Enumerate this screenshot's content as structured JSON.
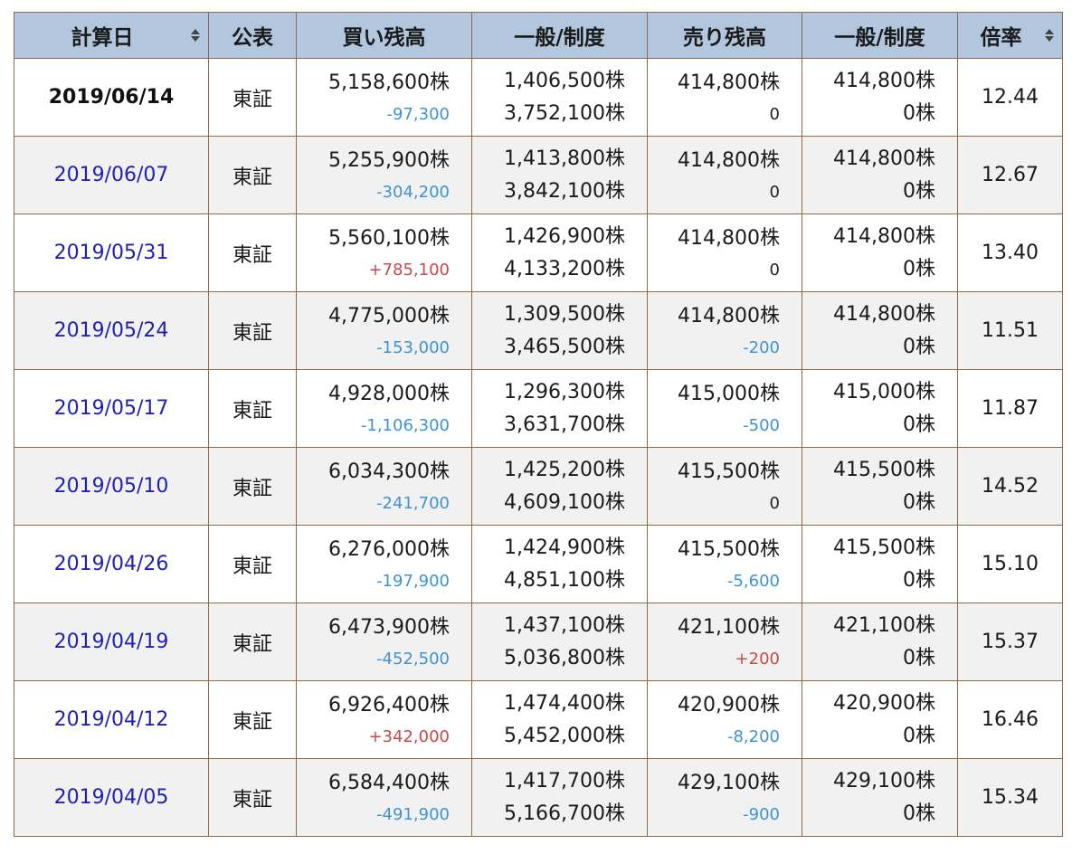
{
  "headers": {
    "date": "計算日",
    "published": "公表",
    "buy_balance": "買い残高",
    "buy_general_system": "一般/制度",
    "sell_balance": "売り残高",
    "sell_general_system": "一般/制度",
    "ratio": "倍率"
  },
  "rows": [
    {
      "date": "2019/06/14",
      "current": true,
      "exchange": "東証",
      "buy": "5,158,600株",
      "buy_diff": "-97,300",
      "buy_diff_sign": "neg",
      "buy_general": "1,406,500株",
      "buy_system": "3,752,100株",
      "sell": "414,800株",
      "sell_diff": "0",
      "sell_diff_sign": "zero",
      "sell_general": "414,800株",
      "sell_system": "0株",
      "ratio": "12.44"
    },
    {
      "date": "2019/06/07",
      "current": false,
      "exchange": "東証",
      "buy": "5,255,900株",
      "buy_diff": "-304,200",
      "buy_diff_sign": "neg",
      "buy_general": "1,413,800株",
      "buy_system": "3,842,100株",
      "sell": "414,800株",
      "sell_diff": "0",
      "sell_diff_sign": "zero",
      "sell_general": "414,800株",
      "sell_system": "0株",
      "ratio": "12.67"
    },
    {
      "date": "2019/05/31",
      "current": false,
      "exchange": "東証",
      "buy": "5,560,100株",
      "buy_diff": "+785,100",
      "buy_diff_sign": "pos",
      "buy_general": "1,426,900株",
      "buy_system": "4,133,200株",
      "sell": "414,800株",
      "sell_diff": "0",
      "sell_diff_sign": "zero",
      "sell_general": "414,800株",
      "sell_system": "0株",
      "ratio": "13.40"
    },
    {
      "date": "2019/05/24",
      "current": false,
      "exchange": "東証",
      "buy": "4,775,000株",
      "buy_diff": "-153,000",
      "buy_diff_sign": "neg",
      "buy_general": "1,309,500株",
      "buy_system": "3,465,500株",
      "sell": "414,800株",
      "sell_diff": "-200",
      "sell_diff_sign": "neg",
      "sell_general": "414,800株",
      "sell_system": "0株",
      "ratio": "11.51"
    },
    {
      "date": "2019/05/17",
      "current": false,
      "exchange": "東証",
      "buy": "4,928,000株",
      "buy_diff": "-1,106,300",
      "buy_diff_sign": "neg",
      "buy_general": "1,296,300株",
      "buy_system": "3,631,700株",
      "sell": "415,000株",
      "sell_diff": "-500",
      "sell_diff_sign": "neg",
      "sell_general": "415,000株",
      "sell_system": "0株",
      "ratio": "11.87"
    },
    {
      "date": "2019/05/10",
      "current": false,
      "exchange": "東証",
      "buy": "6,034,300株",
      "buy_diff": "-241,700",
      "buy_diff_sign": "neg",
      "buy_general": "1,425,200株",
      "buy_system": "4,609,100株",
      "sell": "415,500株",
      "sell_diff": "0",
      "sell_diff_sign": "zero",
      "sell_general": "415,500株",
      "sell_system": "0株",
      "ratio": "14.52"
    },
    {
      "date": "2019/04/26",
      "current": false,
      "exchange": "東証",
      "buy": "6,276,000株",
      "buy_diff": "-197,900",
      "buy_diff_sign": "neg",
      "buy_general": "1,424,900株",
      "buy_system": "4,851,100株",
      "sell": "415,500株",
      "sell_diff": "-5,600",
      "sell_diff_sign": "neg",
      "sell_general": "415,500株",
      "sell_system": "0株",
      "ratio": "15.10"
    },
    {
      "date": "2019/04/19",
      "current": false,
      "exchange": "東証",
      "buy": "6,473,900株",
      "buy_diff": "-452,500",
      "buy_diff_sign": "neg",
      "buy_general": "1,437,100株",
      "buy_system": "5,036,800株",
      "sell": "421,100株",
      "sell_diff": "+200",
      "sell_diff_sign": "pos",
      "sell_general": "421,100株",
      "sell_system": "0株",
      "ratio": "15.37"
    },
    {
      "date": "2019/04/12",
      "current": false,
      "exchange": "東証",
      "buy": "6,926,400株",
      "buy_diff": "+342,000",
      "buy_diff_sign": "pos",
      "buy_general": "1,474,400株",
      "buy_system": "5,452,000株",
      "sell": "420,900株",
      "sell_diff": "-8,200",
      "sell_diff_sign": "neg",
      "sell_general": "420,900株",
      "sell_system": "0株",
      "ratio": "16.46"
    },
    {
      "date": "2019/04/05",
      "current": false,
      "exchange": "東証",
      "buy": "6,584,400株",
      "buy_diff": "-491,900",
      "buy_diff_sign": "neg",
      "buy_general": "1,417,700株",
      "buy_system": "5,166,700株",
      "sell": "429,100株",
      "sell_diff": "-900",
      "sell_diff_sign": "neg",
      "sell_general": "429,100株",
      "sell_system": "0株",
      "ratio": "15.34"
    }
  ]
}
